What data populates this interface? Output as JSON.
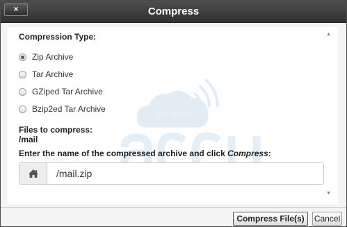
{
  "dialog": {
    "title": "Compress",
    "close_icon": "×",
    "close_icon_name": "close-icon"
  },
  "compression": {
    "label": "Compression Type:",
    "options": [
      {
        "label": "Zip Archive",
        "checked": true
      },
      {
        "label": "Tar Archive",
        "checked": false
      },
      {
        "label": "GZiped Tar Archive",
        "checked": false
      },
      {
        "label": "Bzip2ed Tar Archive",
        "checked": false
      }
    ]
  },
  "files": {
    "label": "Files to compress:",
    "value": "/mail"
  },
  "archive_name": {
    "instruction_prefix": "Enter the name of the compressed archive and click ",
    "instruction_emphasis": "Compress",
    "instruction_suffix": ":",
    "addon_icon": "home-icon",
    "value": "/mail.zip"
  },
  "buttons": {
    "compress": "Compress File(s)",
    "cancel": "Cancel"
  },
  "colors": {
    "titlebar": "#3c3c3c",
    "watermark": "#4a90c8"
  }
}
